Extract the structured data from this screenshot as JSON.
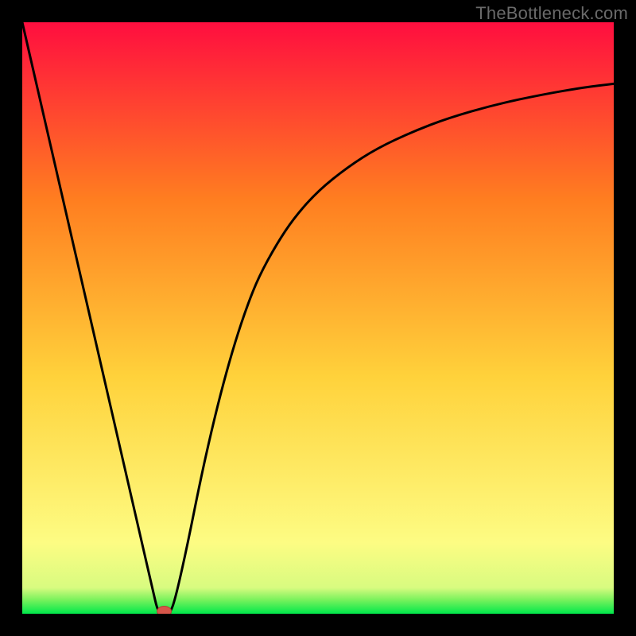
{
  "watermark": "TheBottleneck.com",
  "chart_data": {
    "type": "line",
    "title": "",
    "xlabel": "",
    "ylabel": "",
    "xlim": [
      0,
      100
    ],
    "ylim": [
      0,
      100
    ],
    "curve": {
      "name": "bottleneck-curve",
      "x": [
        0,
        2,
        4,
        6,
        8,
        10,
        12,
        14,
        16,
        18,
        20,
        22,
        23,
        24,
        25,
        26,
        28,
        30,
        32,
        34,
        36,
        38,
        40,
        43,
        46,
        50,
        55,
        60,
        66,
        72,
        80,
        88,
        95,
        100
      ],
      "y": [
        100,
        91.3,
        82.6,
        73.9,
        65.2,
        56.5,
        47.8,
        39.1,
        30.4,
        21.7,
        13.0,
        4.3,
        0.0,
        0.0,
        0.0,
        3.0,
        12.0,
        22.0,
        31.0,
        39.0,
        46.0,
        52.0,
        57.0,
        62.5,
        67.0,
        71.5,
        75.5,
        78.7,
        81.5,
        83.8,
        86.1,
        87.8,
        89.0,
        89.6
      ]
    },
    "marker": {
      "name": "optimal-point",
      "x": 24,
      "y": 0
    },
    "bands": [
      {
        "name": "green",
        "y0": 0.0,
        "y1": 2.4,
        "color_bottom": "#00e84b",
        "color_top": "#7bf25d"
      },
      {
        "name": "lightgreen",
        "y0": 2.4,
        "y1": 4.4,
        "color_bottom": "#7bf25d",
        "color_top": "#d8fb80"
      },
      {
        "name": "paleyellow",
        "y0": 4.4,
        "y1": 12.0,
        "color_bottom": "#d8fb80",
        "color_top": "#fdfc83"
      },
      {
        "name": "yellow",
        "y0": 12.0,
        "y1": 40.0,
        "color_bottom": "#fdfc83",
        "color_top": "#ffd23b"
      },
      {
        "name": "orange",
        "y0": 40.0,
        "y1": 70.0,
        "color_bottom": "#ffd23b",
        "color_top": "#ff7e20"
      },
      {
        "name": "red",
        "y0": 70.0,
        "y1": 100.0,
        "color_bottom": "#ff7e20",
        "color_top": "#ff0e3f"
      }
    ],
    "curve_color": "#000000",
    "curve_width": 3,
    "marker_fill": "#d6564a",
    "marker_stroke": "#b23e33"
  }
}
